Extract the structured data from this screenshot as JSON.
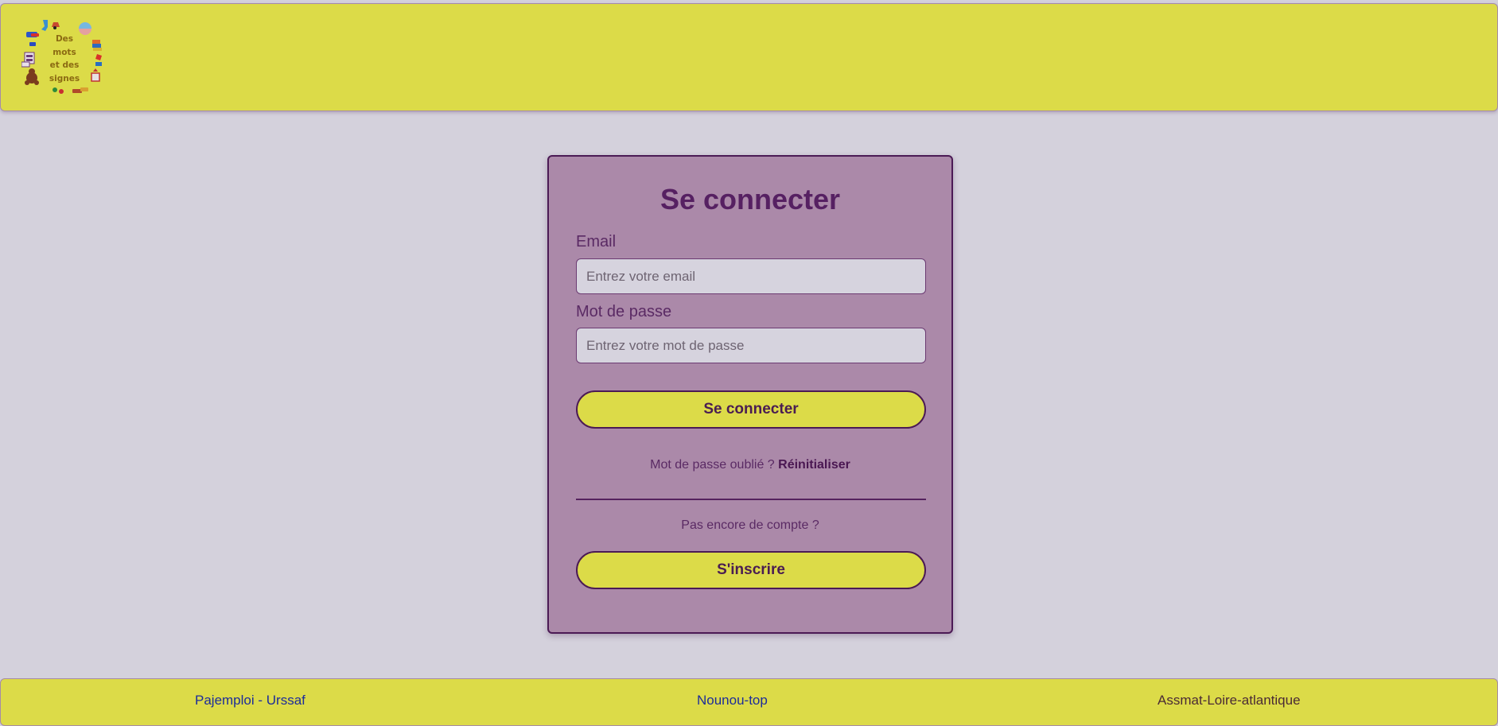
{
  "header": {
    "logo": {
      "icon": "toys-circle-logo-icon",
      "lines": [
        "Des",
        "mots",
        "et des",
        "signes"
      ]
    }
  },
  "login": {
    "title": "Se connecter",
    "email_label": "Email",
    "email_placeholder": "Entrez votre email",
    "email_value": "",
    "password_label": "Mot de passe",
    "password_placeholder": "Entrez votre mot de passe",
    "password_value": "",
    "submit_label": "Se connecter",
    "forgot_text": "Mot de passe oublié ?",
    "forgot_link": "Réinitialiser",
    "no_account_text": "Pas encore de compte ?",
    "signup_label": "S'inscrire"
  },
  "footer": {
    "links": [
      "Pajemploi - Urssaf",
      "Nounou-top",
      "Assmat-Loire-atlantique"
    ]
  },
  "colors": {
    "page_background": "#d4d1dc",
    "header_background": "#dcdb48",
    "card_background": "#ab89a9",
    "accent_text": "#562062",
    "link_blue": "#1d2c9a"
  }
}
